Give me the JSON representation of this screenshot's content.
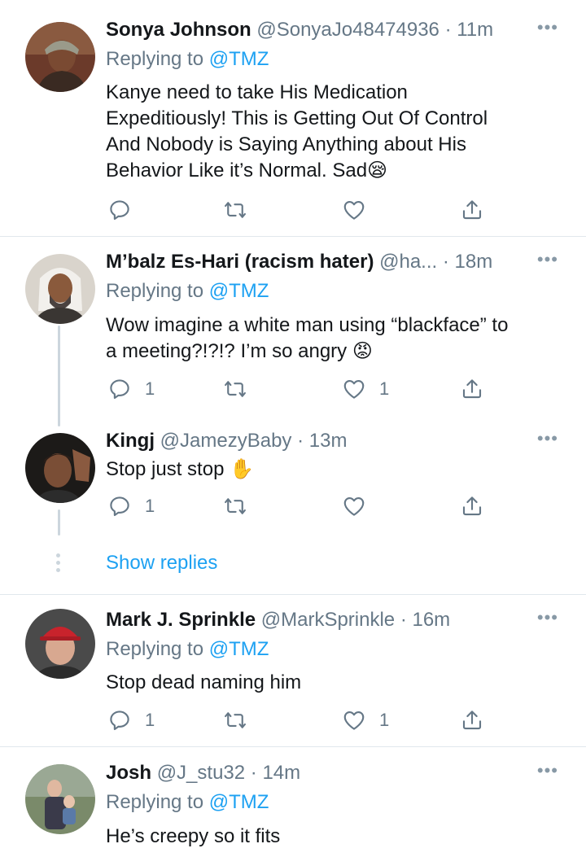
{
  "tweets": [
    {
      "name": "Sonya Johnson",
      "handle": "@SonyaJo48474936",
      "time": "· 11m",
      "replying_label": "Replying to",
      "replying_to": "@TMZ",
      "text_lines": [
        "Kanye need to take His Medication",
        "Expeditiously! This is Getting Out Of Control",
        "And Nobody is Saying Anything about His",
        "Behavior Like it’s Normal. Sad😪"
      ],
      "reply_count": "",
      "retweet_count": "",
      "like_count": ""
    },
    {
      "name": "M’balz Es-Hari (racism hater)",
      "handle": "@ha...",
      "time": "· 18m",
      "replying_label": "Replying to",
      "replying_to": "@TMZ",
      "text_lines": [
        "Wow imagine a white man using “blackface” to",
        "a meeting?!?!? I’m so angry 😡"
      ],
      "reply_count": "1",
      "retweet_count": "",
      "like_count": "1"
    },
    {
      "name": "Kingj",
      "handle": "@JamezyBaby",
      "time": "· 13m",
      "text_lines": [
        "Stop just stop ✋"
      ],
      "reply_count": "1",
      "retweet_count": "",
      "like_count": ""
    },
    {
      "name": "Mark J. Sprinkle",
      "handle": "@MarkSprinkle",
      "time": "· 16m",
      "replying_label": "Replying to",
      "replying_to": "@TMZ",
      "text_lines": [
        "Stop dead naming him"
      ],
      "reply_count": "1",
      "retweet_count": "",
      "like_count": "1"
    },
    {
      "name": "Josh",
      "handle": "@J_stu32",
      "time": "· 14m",
      "replying_label": "Replying to",
      "replying_to": "@TMZ",
      "text_lines": [
        "He’s creepy so it fits"
      ]
    }
  ],
  "show_replies": "Show replies",
  "more_glyph": "•••",
  "colors": {
    "accent": "#1da1f2",
    "secondary_text": "#657786",
    "icon": "#657786",
    "divider": "#e1e8ed",
    "thread_line": "#ccd6dd"
  },
  "icons": {
    "reply": "reply-icon",
    "retweet": "retweet-icon",
    "like": "heart-icon",
    "share": "share-icon",
    "more": "more-icon"
  }
}
